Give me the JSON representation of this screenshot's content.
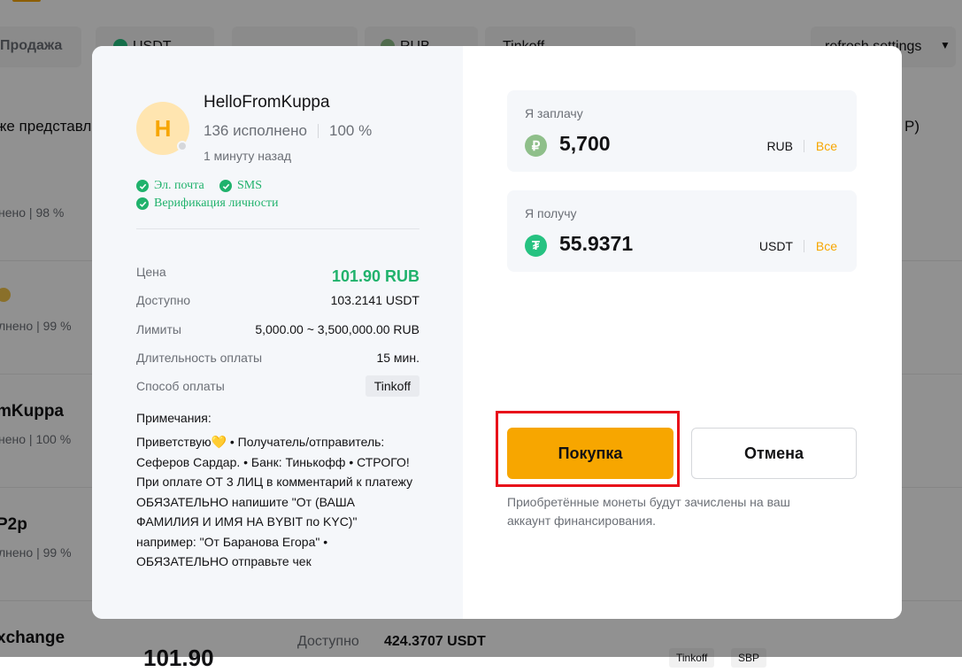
{
  "background": {
    "tab_sell": "Продажа",
    "filter_crypto": "USDT",
    "filter_fiat": "RUB",
    "filter_payment": "Tinkoff",
    "refresh": "refresh settings",
    "row1_name": "же представл",
    "row1_right": "P)",
    "row1_stats": "нено   |   98 %",
    "row2_stats": "лнено   |   99 %",
    "row3_name": "mKuppa",
    "row3_stats": "нено   |   100 %",
    "row4_name": "P2p",
    "row4_stats": "лнено   |   99 %",
    "row5_name": "xchange",
    "row5_price": "101.90",
    "row5_available_label": "Доступно",
    "row5_available_value": "424.3707 USDT",
    "row5_tag1": "Tinkoff",
    "row5_tag2": "SBP"
  },
  "seller": {
    "avatar_letter": "H",
    "name": "HelloFromKuppa",
    "orders": "136 исполнено",
    "completion": "100 %",
    "last_seen": "1 минуту назад",
    "verifications": [
      "Эл. почта",
      "SMS",
      "Верификация личности"
    ]
  },
  "details": {
    "price_label": "Цена",
    "price_value": "101.90 RUB",
    "available_label": "Доступно",
    "available_value": "103.2141 USDT",
    "limits_label": "Лимиты",
    "limits_value": "5,000.00 ~ 3,500,000.00 RUB",
    "duration_label": "Длительность оплаты",
    "duration_value": "15 мин.",
    "method_label": "Способ оплаты",
    "method_value": "Tinkoff"
  },
  "notes": {
    "label": "Примечания:",
    "text": "Приветствую💛 • Получатель/отправитель: Сеферов Сардар. • Банк: Тинькофф • СТРОГО! При оплате ОТ 3 ЛИЦ в комментарий к платежу ОБЯЗАТЕЛЬНО напишите \"От (ВАША ФАМИЛИЯ И ИМЯ НА BYBIT по KYC)\" например: \"От Баранова Егора\" • ОБЯЗАТЕЛЬНО отправьте чек"
  },
  "pay": {
    "caption": "Я заплачу",
    "amount": "5,700",
    "currency": "RUB",
    "all": "Все",
    "icon": "ruble-icon",
    "color": "#8fbf8a"
  },
  "receive": {
    "caption": "Я получу",
    "amount": "55.9371",
    "currency": "USDT",
    "all": "Все",
    "icon": "tether-icon",
    "color": "#26c281"
  },
  "actions": {
    "buy": "Покупка",
    "cancel": "Отмена",
    "hint": "Приобретённые монеты будут зачислены на ваш аккаунт финансирования."
  },
  "colors": {
    "accent": "#f7a600",
    "success": "#20b26c",
    "highlight": "#e8101a"
  }
}
